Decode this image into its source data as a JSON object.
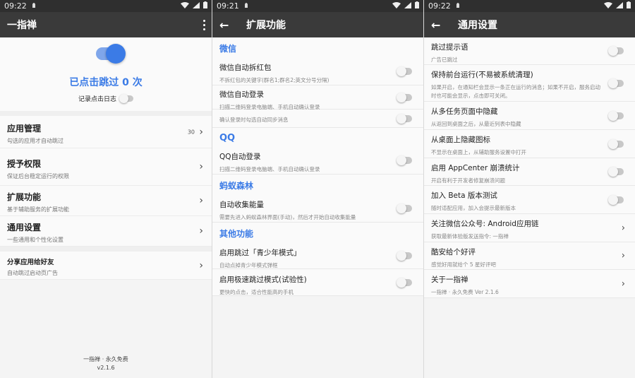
{
  "screens": [
    {
      "status": {
        "time": "09:22"
      },
      "appbar": {
        "title": "一指禅"
      },
      "hero": {
        "title": "已点击跳过 0 次",
        "log_label": "记录点击日志"
      },
      "rows": [
        {
          "title": "应用管理",
          "sub": "勾选的应用才自动跳过",
          "count": "30"
        },
        {
          "title": "授予权限",
          "sub": "保证后台稳定运行的权限"
        },
        {
          "title": "扩展功能",
          "sub": "基于辅助服务的扩展功能"
        },
        {
          "title": "通用设置",
          "sub": "一些通用和个性化设置"
        }
      ],
      "share": {
        "title": "分享应用给好友",
        "sub": "自动跳过启动页广告"
      },
      "footer": {
        "line1": "一指禅 · 永久免费",
        "line2": "v2.1.6"
      }
    },
    {
      "status": {
        "time": "09:21"
      },
      "appbar": {
        "title": "扩展功能"
      },
      "sections": [
        {
          "header": "微信",
          "rows": [
            {
              "title": "微信自动拆红包",
              "sub": "不拆红包的关键字(群名1;群名2;英文分号分隔)"
            },
            {
              "title": "微信自动登录",
              "sub": "扫描二维码登录电脑端、手机自动确认登录"
            },
            {
              "title": "",
              "sub": "确认登录时勾选自动同步消息"
            }
          ]
        },
        {
          "header": "QQ",
          "rows": [
            {
              "title": "QQ自动登录",
              "sub": "扫描二维码登录电脑端、手机自动确认登录"
            }
          ]
        },
        {
          "header": "蚂蚁森林",
          "rows": [
            {
              "title": "自动收集能量",
              "sub": "需要先进入蚂蚁森林界面(手动)，然后才开始自动收集能量"
            }
          ]
        },
        {
          "header": "其他功能",
          "rows": [
            {
              "title": "启用跳过「青少年模式」",
              "sub": "自动点掉青少年模式弹框"
            },
            {
              "title": "启用极速跳过模式(试验性)",
              "sub": "更快的点击，适合性能高的手机"
            }
          ]
        }
      ]
    },
    {
      "status": {
        "time": "09:22"
      },
      "appbar": {
        "title": "通用设置"
      },
      "rows": [
        {
          "title": "跳过提示语",
          "sub": "广告已跳过",
          "control": "toggle"
        },
        {
          "title": "保持前台运行(不易被系统清理)",
          "sub": "如果开启，在通知栏会显示一条正在运行的消息；如果不开启，服务启动时也可能会显示，点击即可关闭。",
          "control": "toggle"
        },
        {
          "title": "从多任务页面中隐藏",
          "sub": "从返回到桌面之后，从最近列表中隐藏",
          "control": "toggle"
        },
        {
          "title": "从桌面上隐藏图标",
          "sub": "不显示在桌面上，从辅助服务设置中打开",
          "control": "toggle"
        },
        {
          "title": "启用 AppCenter 崩溃统计",
          "sub": "开启有利于开发者修复崩溃问题",
          "control": "toggle"
        },
        {
          "title": "加入 Beta 版本测试",
          "sub": "随时适配应用，加入会提示最新版本",
          "control": "toggle"
        },
        {
          "title": "关注微信公众号: Android应用链",
          "sub": "获取最新体验版发送指令: 一指禅",
          "control": "chevron"
        },
        {
          "title": "酷安给个好评",
          "sub": "感觉好用就给个 5 星好评吧",
          "control": "chevron"
        },
        {
          "title": "关于一指禅",
          "sub": "一指禅 · 永久免费 Ver 2.1.6",
          "control": "chevron"
        }
      ]
    }
  ],
  "colors": {
    "accent": "#3b7be6",
    "appbar": "#3a3a3a",
    "statusbar": "#2f2f2f"
  },
  "icons": [
    "back-arrow-icon",
    "overflow-menu-icon",
    "chevron-right-icon",
    "wifi-icon",
    "signal-icon",
    "battery-icon",
    "notification-icon"
  ]
}
